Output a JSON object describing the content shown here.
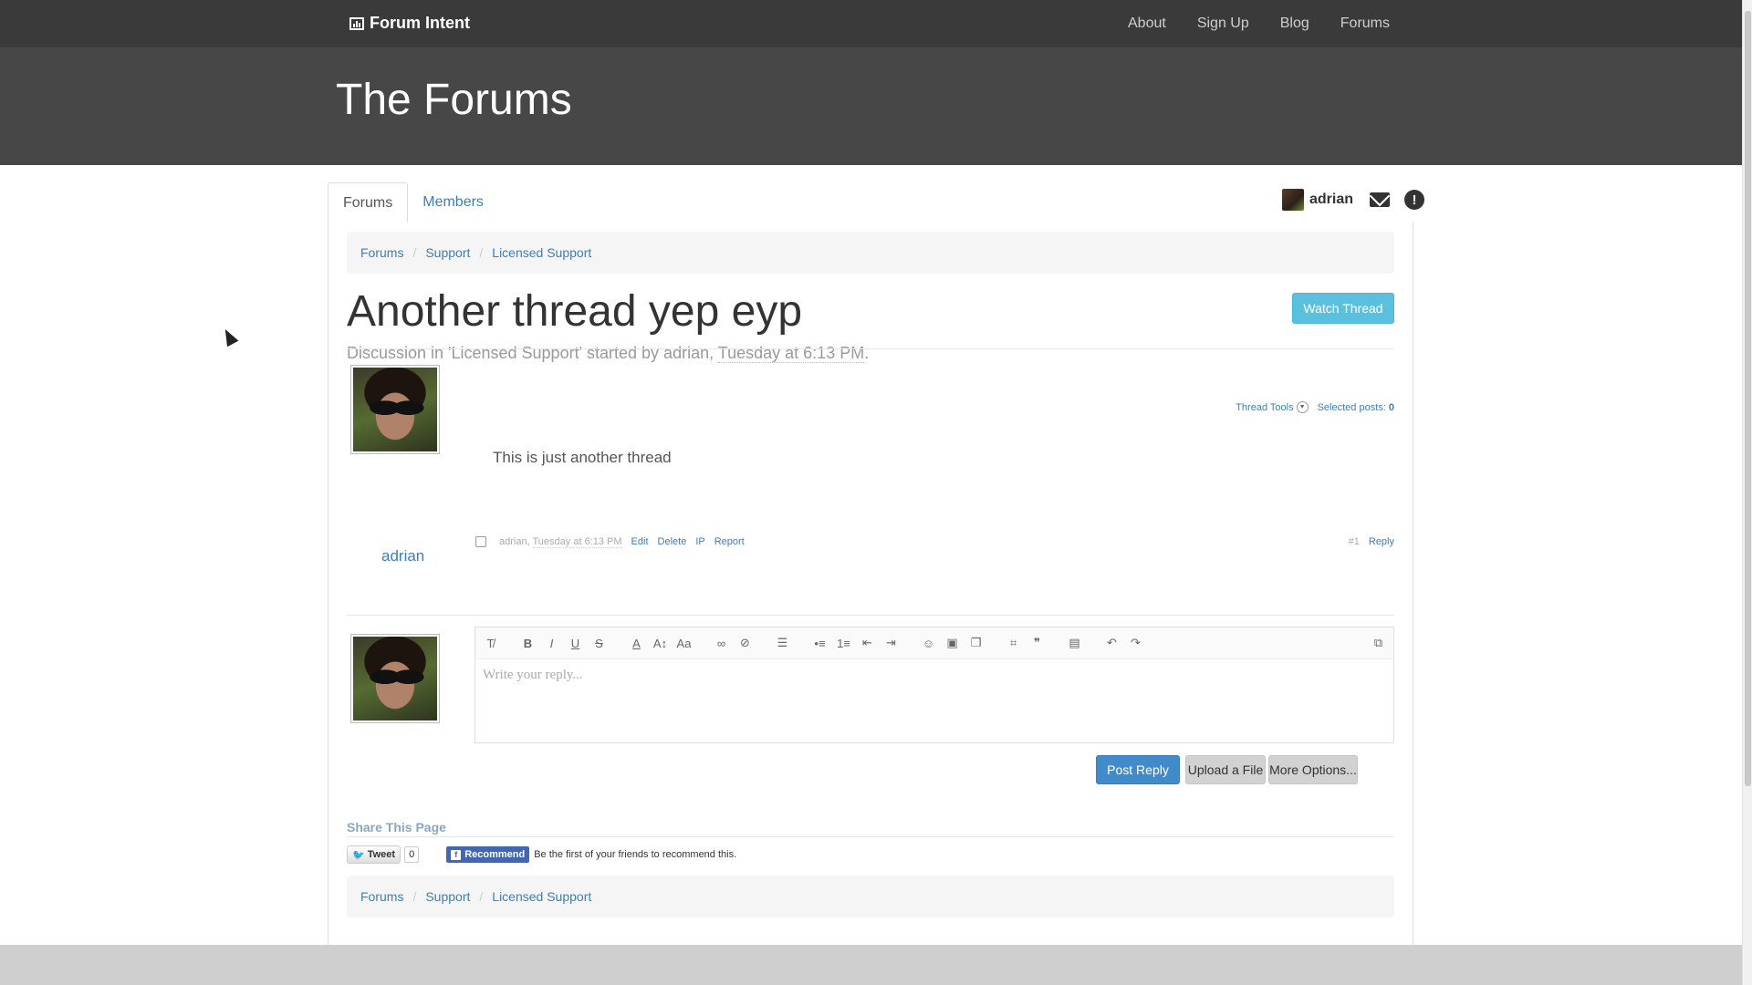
{
  "navbar": {
    "brand": "Forum Intent",
    "links": [
      "About",
      "Sign Up",
      "Blog",
      "Forums"
    ]
  },
  "hero": {
    "title": "The Forums"
  },
  "tabs": [
    "Forums",
    "Members"
  ],
  "user": {
    "name": "adrian"
  },
  "breadcrumb": [
    "Forums",
    "Support",
    "Licensed Support"
  ],
  "thread": {
    "title": "Another thread yep eyp",
    "watch_label": "Watch Thread",
    "discussion_prefix": "Discussion in 'Licensed Support' started by adrian, ",
    "discussion_date": "Tuesday at 6:13 PM",
    "discussion_suffix": "."
  },
  "thread_tools": {
    "label": "Thread Tools",
    "selected_label": "Selected posts: ",
    "selected_count": "0"
  },
  "post": {
    "author": "adrian",
    "body": "This is just another thread",
    "meta_author": "adrian, ",
    "meta_date": "Tuesday at 6:13 PM",
    "actions": [
      "Edit",
      "Delete",
      "IP",
      "Report"
    ],
    "number": "#1",
    "reply_label": "Reply"
  },
  "editor": {
    "placeholder": "Write your reply..."
  },
  "buttons": {
    "post_reply": "Post Reply",
    "upload": "Upload a File",
    "more": "More Options..."
  },
  "share": {
    "title": "Share This Page",
    "tweet": "Tweet",
    "tweet_count": "0",
    "recommend": "Recommend",
    "fb_text": "Be the first of your friends to recommend this."
  },
  "colors": {
    "navbar": "#3a3a3a",
    "hero": "#474747",
    "link": "#3b7fb8",
    "info_button": "#5bc0de",
    "primary_button": "#428bca"
  }
}
